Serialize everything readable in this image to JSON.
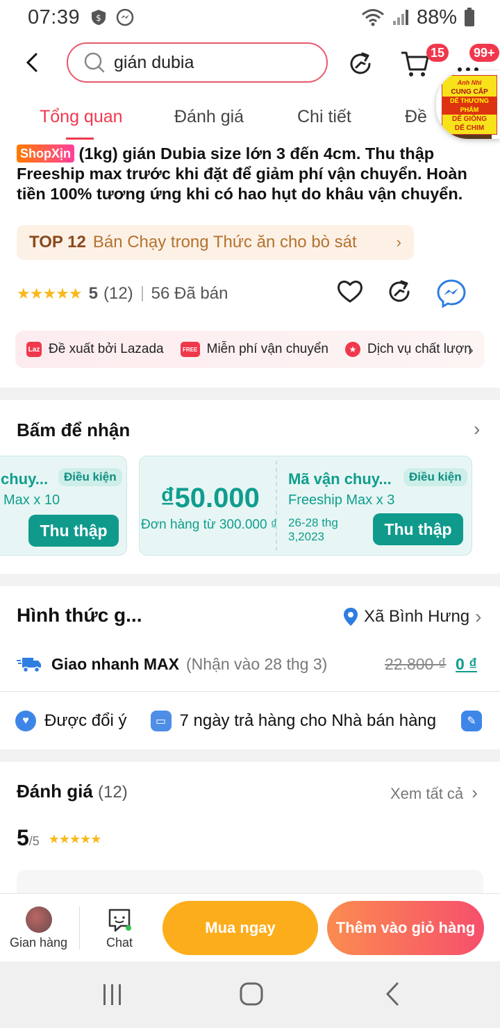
{
  "status_bar": {
    "time": "07:39",
    "battery": "88%",
    "icons": [
      "shield-dollar-icon",
      "messenger-icon",
      "wifi-icon",
      "signal-icon",
      "battery-icon"
    ]
  },
  "top_bar": {
    "search_text": "gián dubia",
    "cart_badge": "15",
    "more_badge": "99+",
    "float_ad_lines": [
      "Anh Nhi",
      "CUNG CẤP",
      "DẾ THƯƠNG PHẨM",
      "DẾ GIỐNG",
      "DẾ CHIM"
    ]
  },
  "tabs": [
    {
      "label": "Tổng quan",
      "active": true
    },
    {
      "label": "Đánh giá",
      "active": false
    },
    {
      "label": "Chi tiết",
      "active": false
    },
    {
      "label": "Đề",
      "active": false
    }
  ],
  "product": {
    "badge": "ShopXịn",
    "title": "(1kg) gián Dubia size lớn 3 đến 4cm. Thu thập Freeship max trước khi đặt để giảm phí vận chuyển. Hoàn tiền 100% tương ứng khi có hao hụt do khâu vận chuyển."
  },
  "top_rank": {
    "rank": "TOP 12",
    "category": "Bán Chạy trong Thức ăn cho bò sát"
  },
  "rating": {
    "stars": "★★★★★",
    "score": "5",
    "count": "(12)",
    "sold": "56 Đã bán"
  },
  "features": [
    {
      "label": "Đề xuất bởi Lazada",
      "icon": "Laz",
      "color": "#f0384c"
    },
    {
      "label": "Miễn phí vận chuyển",
      "icon": "FREE",
      "color": "#f0384c"
    },
    {
      "label": "Dịch vụ chất lượn",
      "icon": "★",
      "color": "#f0384c"
    }
  ],
  "vouchers_section": {
    "title": "Bấm để nhận",
    "vouchers": [
      {
        "title": "chuy...",
        "sub": "Max x 10",
        "condition": "Điều kiện",
        "button": "Thu thập"
      },
      {
        "amount": "₫50.000",
        "min_order": "Đơn hàng từ 300.000 ₫",
        "title": "Mã vận chuy...",
        "sub": "Freeship Max x 3",
        "date": "26-28 thg 3,2023",
        "condition": "Điều kiện",
        "button": "Thu thập"
      }
    ]
  },
  "shipping": {
    "title": "Hình thức g...",
    "location": "Xã Bình Hưng",
    "method": "Giao nhanh MAX",
    "eta": "(Nhận vào 28 thg 3)",
    "old_price": "22.800 ₫",
    "new_price": "0 ₫",
    "policies": [
      "Được đổi ý",
      "7 ngày trả hàng cho Nhà bán hàng"
    ]
  },
  "reviews": {
    "title": "Đánh giá",
    "count": "(12)",
    "see_all": "Xem tất cả",
    "score": "5",
    "of": "/5",
    "stars": "★★★★★"
  },
  "bottom_bar": {
    "store": "Gian hàng",
    "chat": "Chat",
    "buy_now": "Mua ngay",
    "add_to_cart": "Thêm vào giỏ hàng"
  }
}
